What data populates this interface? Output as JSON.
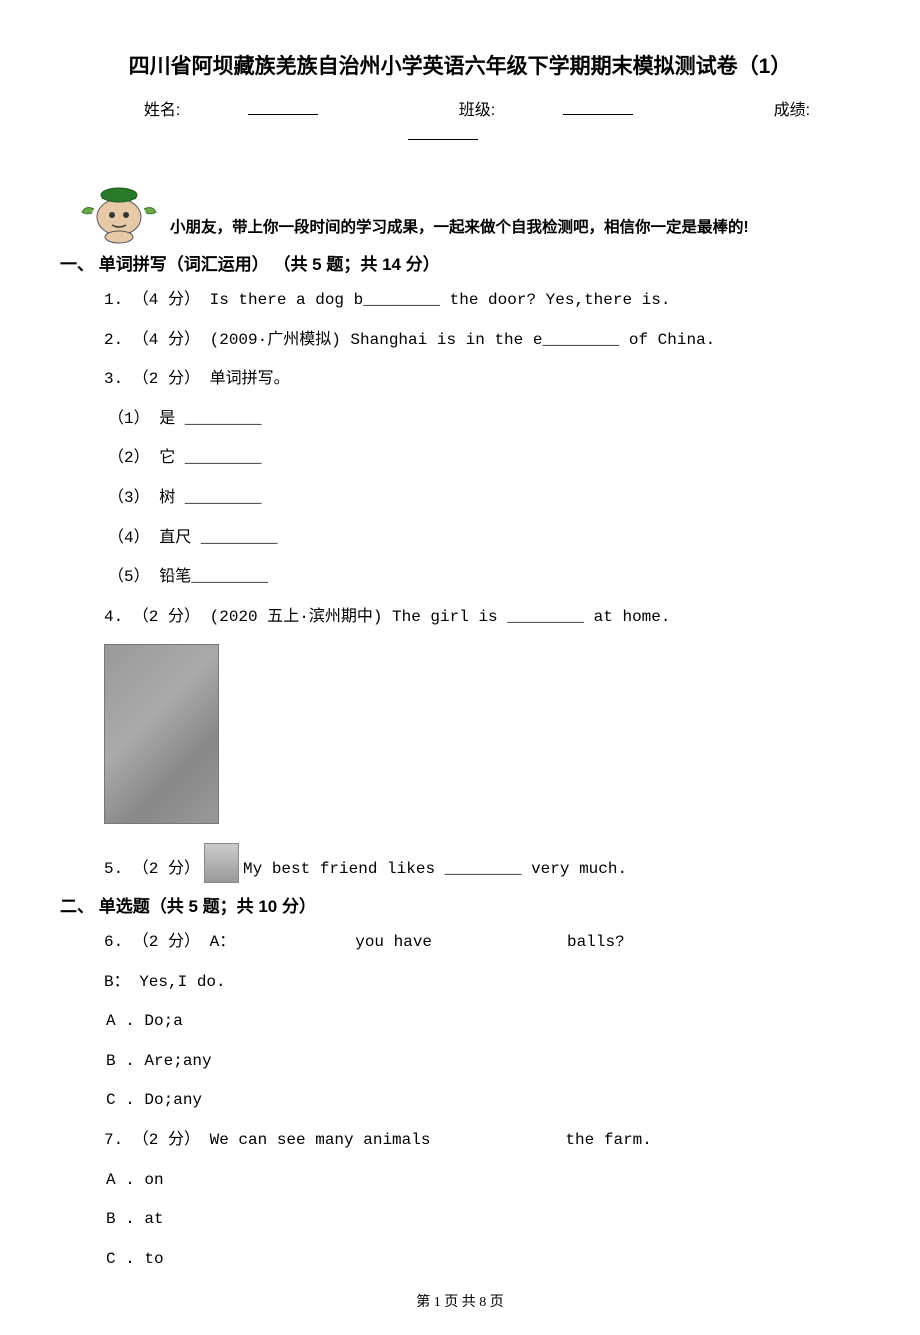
{
  "title": "四川省阿坝藏族羌族自治州小学英语六年级下学期期末模拟测试卷（1）",
  "info": {
    "name_label": "姓名:",
    "class_label": "班级:",
    "score_label": "成绩:"
  },
  "intro": "小朋友，带上你一段时间的学习成果，一起来做个自我检测吧，相信你一定是最棒的!",
  "section1": {
    "header": "一、 单词拼写（词汇运用） （共 5 题；共 14 分）",
    "q1": "1. （4 分） Is there a dog b________ the door?  Yes,there is.",
    "q2": "2. （4 分） (2009·广州模拟) Shanghai is in the e________ of China.",
    "q3": "3. （2 分）      单词拼写。",
    "q3_sub": [
      "（1） 是 ________",
      "（2） 它 ________",
      "（3） 树 ________",
      "（4） 直尺 ________",
      "（5） 铅笔________"
    ],
    "q4": "4. （2 分） (2020 五上·滨州期中) The girl is ________ at home.",
    "q5_prefix": "5. （2 分）",
    "q5_suffix": " My best friend likes ________ very much."
  },
  "section2": {
    "header": "二、 单选题（共 5 题；共 10 分）",
    "q6": {
      "a_line": "6. （2 分） A：",
      "a_mid1": "you have",
      "a_mid2": "balls?",
      "b_line": "B： Yes,I do.",
      "options": [
        "A . Do;a",
        "B . Are;any",
        "C . Do;any"
      ]
    },
    "q7": {
      "line": "7. （2 分） We can see many animals",
      "tail": "the farm.",
      "options": [
        "A . on",
        "B . at",
        "C . to"
      ]
    }
  },
  "footer": "第 1 页 共 8 页"
}
